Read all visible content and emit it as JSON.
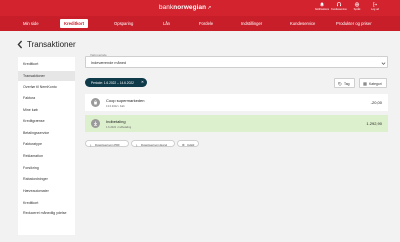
{
  "header": {
    "logo_bank": "bank",
    "logo_norwegian": "norwegian",
    "tools": [
      {
        "label": "Notifications",
        "icon": "bell-icon"
      },
      {
        "label": "Kundeservice",
        "icon": "headset-icon"
      },
      {
        "label": "Språk",
        "icon": "globe-icon"
      },
      {
        "label": "Log ud",
        "icon": "logout-icon"
      }
    ]
  },
  "nav": {
    "items": [
      "Min side",
      "Kreditkort",
      "Opsparing",
      "Lån",
      "Fordele",
      "Indstillinger",
      "Kundeservice",
      "Produkter og priser"
    ],
    "active_index": 1
  },
  "page": {
    "title": "Transaktioner",
    "back_icon": "chevron-left-icon"
  },
  "sidebar": {
    "items": [
      "Kreditkort",
      "Transaktioner",
      "Overfør til NemKonto",
      "Faktura",
      "Mine køb",
      "Kreditgrænse",
      "Betalingsservice",
      "Fakturatype",
      "Reklamation",
      "Forsikring",
      "Rabatordninger",
      "Hæveautomater",
      "Kreditkort",
      "Reduceret månedlig ydelse"
    ],
    "active_index": 1
  },
  "filter": {
    "period_label": "Vælg periode",
    "period_value": "Indeværende måned",
    "date_range": "Periode: 1.6.2022 – 14.6.2022",
    "tag_label": "Tag",
    "category_label": "Kategori"
  },
  "transactions": [
    {
      "name": "Coop supermarkeden",
      "meta": "13.6.2022 • Køb",
      "amount": "-20,00",
      "highlight": false
    },
    {
      "name": "Indbetaling",
      "meta": "1.6.2022 • Indbetaling",
      "amount": "1.292,90",
      "highlight": true
    }
  ],
  "actions": [
    {
      "label": "Download som PDF",
      "icon": "download-icon"
    },
    {
      "label": "Download som Excel",
      "icon": "download-icon"
    },
    {
      "label": "Indstil",
      "icon": "gear-icon"
    }
  ],
  "colors": {
    "brand_red": "#d3232f",
    "nav_red": "#c81e2a",
    "chip_navy": "#0f3a4a",
    "credit_green": "#ddf0cd"
  }
}
